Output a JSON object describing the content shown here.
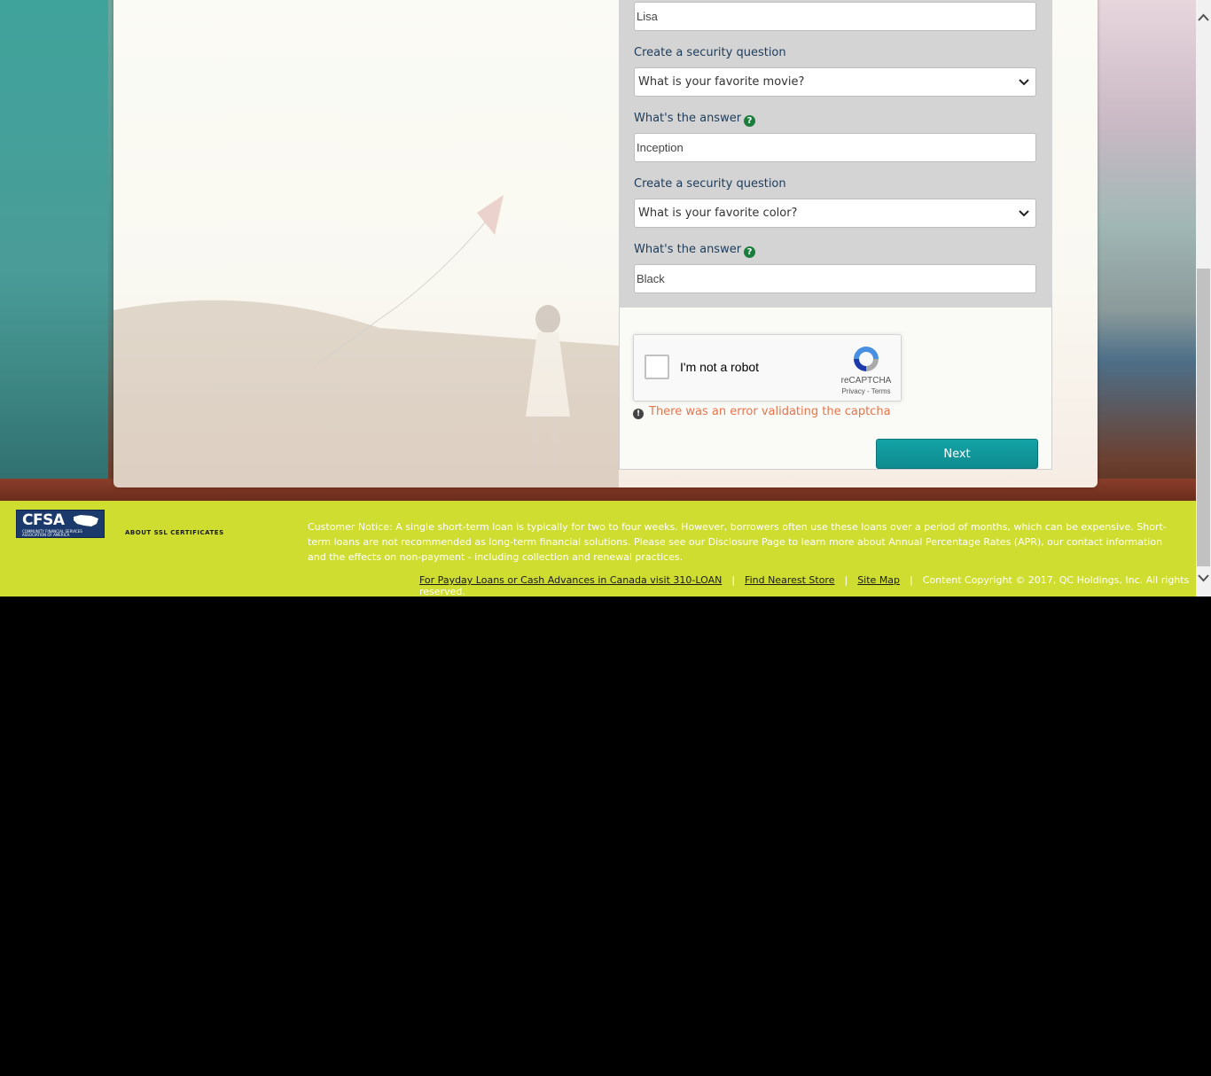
{
  "form": {
    "name_value": "Lisa",
    "question1_label": "Create a security question",
    "question1_value": "What is your favorite movie?",
    "answer1_label": "What's the answer",
    "answer1_value": "Inception",
    "question2_label": "Create a security question",
    "question2_value": "What is your favorite color?",
    "answer2_label": "What's the answer",
    "answer2_value": "Black",
    "help_glyph": "?"
  },
  "captcha": {
    "label": "I'm not a robot",
    "brand": "reCAPTCHA",
    "links": "Privacy - Terms",
    "error": "There was an error validating the captcha",
    "error_glyph": "!"
  },
  "next_label": "Next",
  "footer": {
    "logo_text": "CFSA",
    "logo_sub": "COMMUNITY FINANCIAL SERVICES ASSOCIATION OF AMERICA",
    "ssl_label": "ABOUT SSL CERTIFICATES",
    "notice": "Customer Notice: A single short-term loan is typically for two to four weeks. However, borrowers often use these loans over a period of months, which can be expensive. Short-term loans are not recommended as long-term financial solutions. Please see our Disclosure Page to learn more about Annual Percentage Rates (APR), our contact information and the effects on non-payment - including collection and renewal practices.",
    "links": [
      "For Payday Loans or Cash Advances in Canada visit 310-LOAN",
      "Find Nearest Store",
      "Site Map"
    ],
    "separator": "|",
    "copyright": "Content Copyright © 2017, QC Holdings, Inc. All rights reserved."
  },
  "colors": {
    "accent": "#0d8b8f",
    "footer_bg": "#cedd2f",
    "error": "#e8744c",
    "help": "#1a7d3c"
  },
  "icons": [
    "chevron-down-icon",
    "help-icon",
    "error-icon",
    "recaptcha-icon",
    "usa-map-icon",
    "scroll-up-icon",
    "scroll-down-icon"
  ]
}
